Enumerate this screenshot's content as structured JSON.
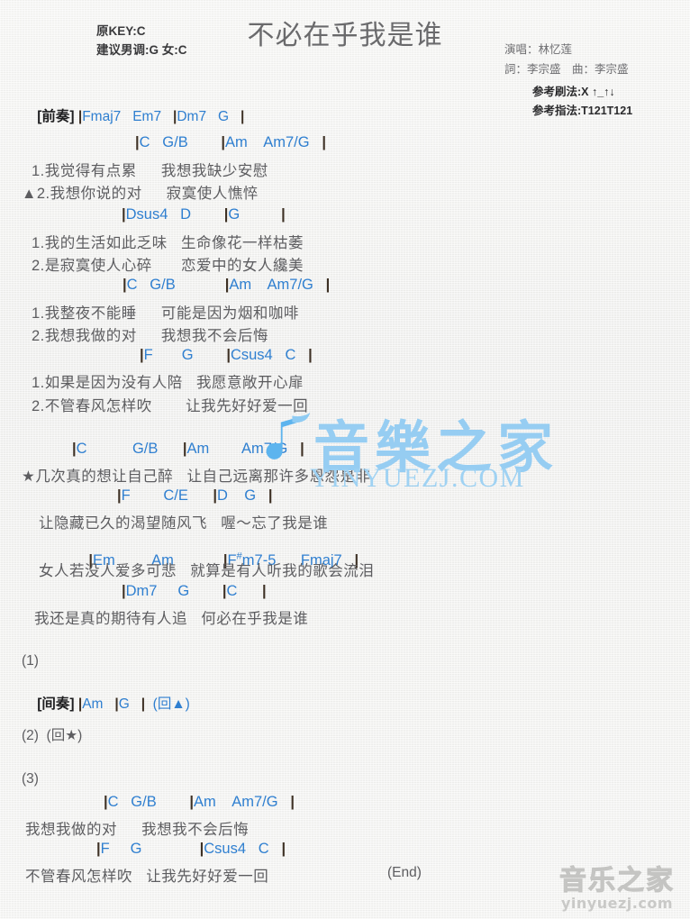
{
  "header": {
    "original_key": "原KEY:C",
    "suggested_key": "建议男调:G 女:C",
    "title": "不必在乎我是谁",
    "singer": "演唱：林忆莲",
    "writers": "詞：李宗盛　曲：李宗盛",
    "strum_ref": "参考刷法:X ↑_↑↓",
    "fingering_ref": "参考指法:T121T121"
  },
  "colors": {
    "chord": "#2f7fd0",
    "bar": "#3d3024",
    "lyric": "#5d5d60",
    "title": "#6a6a6c",
    "watermark_blue": "#96cdf2",
    "watermark_grey": "#ccccca",
    "page_bg": "#f2f2f0"
  },
  "intro": {
    "tag": "[前奏]",
    "chords": "|Fmaj7   Em7   |Dm7   G   |"
  },
  "blocks": [
    {
      "chords": "|C   G/B        |Am    Am7/G   |",
      "lyrics": [
        "1.我觉得有点累　  我想我缺少安慰",
        "▲2.我想你说的对　  寂寞使人憔悴"
      ]
    },
    {
      "chords": "|Dsus4   D        |G          |",
      "lyrics": [
        "1.我的生活如此乏味   生命像花一样枯萎",
        "2.是寂寞使人心碎　   恋爱中的女人纔美"
      ]
    },
    {
      "chords": "|C   G/B            |Am    Am7/G   |",
      "lyrics": [
        "1.我整夜不能睡　  可能是因为烟和咖啡",
        "2.我想我做的对　  我想我不会后悔"
      ]
    },
    {
      "chords": "|F       G        |Csus4   C   |",
      "lyrics": [
        "1.如果是因为没有人陪   我愿意敞开心扉",
        "2.不管春风怎样吹　    让我先好好爱一回"
      ]
    },
    {
      "chords": "|C           G/B      |Am        Am7/G   |",
      "lyrics": [
        "★几次真的想让自己醉   让自己远离那许多恩怨是非"
      ]
    },
    {
      "chords": "|F        C/E      |D    G   |",
      "lyrics": [
        "让隐藏已久的渴望随风飞   喔～忘了我是谁"
      ]
    },
    {
      "chords": "|Em         Am            |F#m7-5      Fmaj7   |",
      "chords_sharp": true,
      "lyrics": [
        "女人若没人爱多可悲   就算是有人听我的歌会流泪"
      ]
    },
    {
      "chords": "|Dm7     G        |C      |",
      "lyrics": [
        "我还是真的期待有人追   何必在乎我是谁"
      ]
    }
  ],
  "sections": [
    {
      "number": "(1)"
    },
    {
      "tag": "[间奏]",
      "chords": "|Am   |G   |  (回▲)"
    },
    {
      "number": "(2)  (回★)"
    },
    {
      "number": "(3)"
    }
  ],
  "outro": {
    "blocks": [
      {
        "chords": "|C   G/B        |Am    Am7/G   |",
        "lyrics": [
          "我想我做的对　  我想我不会后悔"
        ]
      },
      {
        "chords": "|F     G              |Csus4   C   |",
        "lyrics": [
          "不管春风怎样吹   让我先好好爱一回"
        ]
      }
    ],
    "end_marker": "(End)"
  },
  "watermarks": {
    "center_logo": "音樂之家",
    "center_url": "YINYUEZJ.COM",
    "corner_logo": "音乐之家",
    "corner_url": "yinyuezj.com"
  }
}
